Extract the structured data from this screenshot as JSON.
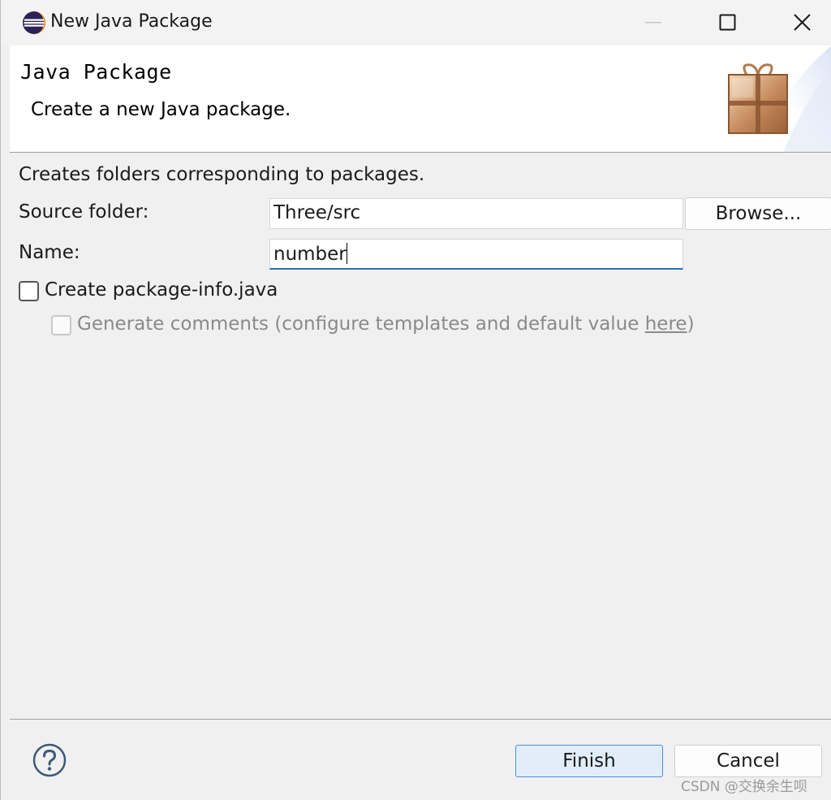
{
  "window": {
    "title": "New Java Package",
    "app_icon": "eclipse-icon",
    "controls": {
      "minimize": "minimize-icon",
      "maximize": "maximize-icon",
      "close": "close-icon"
    }
  },
  "banner": {
    "title": "Java Package",
    "description": "Create a new Java package.",
    "image": "package-wizard-image"
  },
  "content": {
    "description": "Creates folders corresponding to packages.",
    "source_folder": {
      "label": "Source folder:",
      "value": "Three/src",
      "browse_label": "Browse..."
    },
    "name": {
      "label": "Name:",
      "value": "number"
    },
    "create_package_info": {
      "label": "Create package-info.java",
      "checked": false
    },
    "generate_comments": {
      "label": "Generate comments",
      "hint_prefix": "(configure templates and default value ",
      "link": "here",
      "hint_suffix": ")",
      "checked": false,
      "enabled": false
    }
  },
  "footer": {
    "help_icon": "help-icon",
    "finish_label": "Finish",
    "cancel_label": "Cancel"
  },
  "watermark": "CSDN @交换余生呗",
  "colors": {
    "accent": "#2a6fb8",
    "finish_bg": "#e1edf9",
    "finish_border": "#4a90d9"
  }
}
